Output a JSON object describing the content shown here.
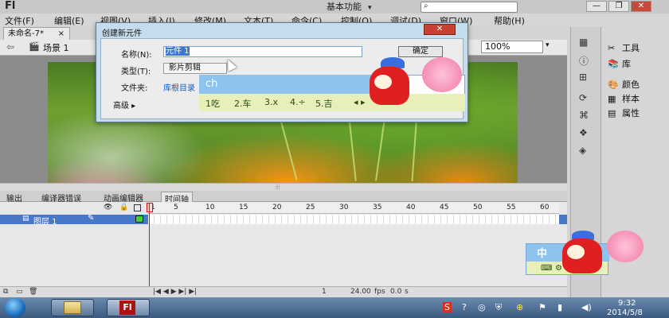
{
  "app": {
    "logo": "Fl",
    "workspace": "基本功能",
    "workspace_arrow": "▾",
    "search_placeholder": ""
  },
  "window": {
    "minimize": "—",
    "restore": "❐",
    "close": "✕"
  },
  "menu": [
    "文件(F)",
    "编辑(E)",
    "视图(V)",
    "插入(I)",
    "修改(M)",
    "文本(T)",
    "命令(C)",
    "控制(O)",
    "调试(D)",
    "窗口(W)",
    "帮助(H)"
  ],
  "doc_tab": {
    "title": "未命名-7*",
    "close": "×"
  },
  "stagebar": {
    "scene": "场景 1",
    "zoom": "100%"
  },
  "dialog": {
    "title": "创建新元件",
    "name_label": "名称(N):",
    "name_value": "元件 1",
    "type_label": "类型(T):",
    "type_value": "影片剪辑",
    "folder_label": "文件夹:",
    "folder_value": "库根目录",
    "advanced": "高级 ▸",
    "ok": "确定",
    "close": "✕"
  },
  "ime": {
    "input": "ch",
    "candidates": [
      "1吃",
      "2.车",
      "3.x",
      "4.÷",
      "5.吉"
    ],
    "status": "中",
    "status_icons": [
      "⌨",
      "⚙"
    ]
  },
  "timeline": {
    "tabs": [
      "输出",
      "编译器错误",
      "动画编辑器",
      "时间轴"
    ],
    "active_tab": 3,
    "ruler": [
      "1",
      "5",
      "10",
      "15",
      "20",
      "25",
      "30",
      "35",
      "40",
      "45",
      "50",
      "55",
      "60"
    ],
    "layer_name": "图层 1",
    "status": {
      "frame": "1",
      "fps": "24.00",
      "fps_unit": "fps",
      "time": "0.0",
      "time_unit": "s"
    }
  },
  "panels": {
    "tools": "工具",
    "library": "库",
    "color": "颜色",
    "swatches": "样本",
    "properties": "属性"
  },
  "taskbar": {
    "app": "Fl",
    "time": "9:32",
    "date": "2014/5/8"
  }
}
